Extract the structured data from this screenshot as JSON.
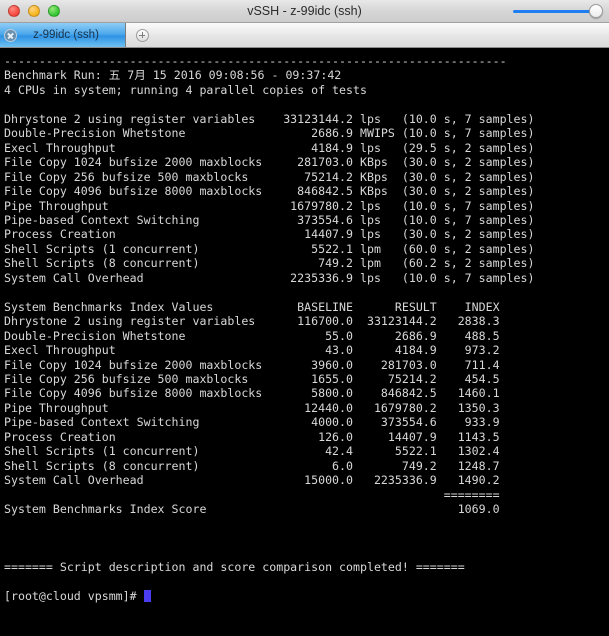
{
  "window": {
    "title": "vSSH - z-99idc (ssh)",
    "traffic_lights": [
      "close",
      "minimize",
      "zoom"
    ],
    "slider_value": 100
  },
  "tabs": {
    "items": [
      {
        "label": "z-99idc (ssh)",
        "active": true,
        "close_icon": "close-icon"
      }
    ],
    "new_tab_icon": "plus-icon"
  },
  "terminal": {
    "separator_top": "------------------------------------------------------------------------",
    "header": {
      "benchmark_run": "Benchmark Run: 五 7月 15 2016 09:08:56 - 09:37:42",
      "cpus": "4 CPUs in system; running 4 parallel copies of tests"
    },
    "results": [
      {
        "name": "Dhrystone 2 using register variables",
        "value": "33123144.2",
        "unit": "lps",
        "detail": "(10.0 s, 7 samples)"
      },
      {
        "name": "Double-Precision Whetstone",
        "value": "2686.9",
        "unit": "MWIPS",
        "detail": "(10.0 s, 7 samples)"
      },
      {
        "name": "Execl Throughput",
        "value": "4184.9",
        "unit": "lps",
        "detail": "(29.5 s, 2 samples)"
      },
      {
        "name": "File Copy 1024 bufsize 2000 maxblocks",
        "value": "281703.0",
        "unit": "KBps",
        "detail": "(30.0 s, 2 samples)"
      },
      {
        "name": "File Copy 256 bufsize 500 maxblocks",
        "value": "75214.2",
        "unit": "KBps",
        "detail": "(30.0 s, 2 samples)"
      },
      {
        "name": "File Copy 4096 bufsize 8000 maxblocks",
        "value": "846842.5",
        "unit": "KBps",
        "detail": "(30.0 s, 2 samples)"
      },
      {
        "name": "Pipe Throughput",
        "value": "1679780.2",
        "unit": "lps",
        "detail": "(10.0 s, 7 samples)"
      },
      {
        "name": "Pipe-based Context Switching",
        "value": "373554.6",
        "unit": "lps",
        "detail": "(10.0 s, 7 samples)"
      },
      {
        "name": "Process Creation",
        "value": "14407.9",
        "unit": "lps",
        "detail": "(30.0 s, 2 samples)"
      },
      {
        "name": "Shell Scripts (1 concurrent)",
        "value": "5522.1",
        "unit": "lpm",
        "detail": "(60.0 s, 2 samples)"
      },
      {
        "name": "Shell Scripts (8 concurrent)",
        "value": "749.2",
        "unit": "lpm",
        "detail": "(60.2 s, 2 samples)"
      },
      {
        "name": "System Call Overhead",
        "value": "2235336.9",
        "unit": "lps",
        "detail": "(10.0 s, 7 samples)"
      }
    ],
    "index_table": {
      "title": "System Benchmarks Index Values",
      "columns": [
        "BASELINE",
        "RESULT",
        "INDEX"
      ],
      "rows": [
        {
          "name": "Dhrystone 2 using register variables",
          "baseline": "116700.0",
          "result": "33123144.2",
          "index": "2838.3"
        },
        {
          "name": "Double-Precision Whetstone",
          "baseline": "55.0",
          "result": "2686.9",
          "index": "488.5"
        },
        {
          "name": "Execl Throughput",
          "baseline": "43.0",
          "result": "4184.9",
          "index": "973.2"
        },
        {
          "name": "File Copy 1024 bufsize 2000 maxblocks",
          "baseline": "3960.0",
          "result": "281703.0",
          "index": "711.4"
        },
        {
          "name": "File Copy 256 bufsize 500 maxblocks",
          "baseline": "1655.0",
          "result": "75214.2",
          "index": "454.5"
        },
        {
          "name": "File Copy 4096 bufsize 8000 maxblocks",
          "baseline": "5800.0",
          "result": "846842.5",
          "index": "1460.1"
        },
        {
          "name": "Pipe Throughput",
          "baseline": "12440.0",
          "result": "1679780.2",
          "index": "1350.3"
        },
        {
          "name": "Pipe-based Context Switching",
          "baseline": "4000.0",
          "result": "373554.6",
          "index": "933.9"
        },
        {
          "name": "Process Creation",
          "baseline": "126.0",
          "result": "14407.9",
          "index": "1143.5"
        },
        {
          "name": "Shell Scripts (1 concurrent)",
          "baseline": "42.4",
          "result": "5522.1",
          "index": "1302.4"
        },
        {
          "name": "Shell Scripts (8 concurrent)",
          "baseline": "6.0",
          "result": "749.2",
          "index": "1248.7"
        },
        {
          "name": "System Call Overhead",
          "baseline": "15000.0",
          "result": "2235336.9",
          "index": "1490.2"
        }
      ],
      "score_separator": "========",
      "score_label": "System Benchmarks Index Score",
      "score_value": "1069.0"
    },
    "footer_message": "======= Script description and score comparison completed! =======",
    "prompt": "[root@cloud vpsmm]# ",
    "cursor": "block"
  }
}
